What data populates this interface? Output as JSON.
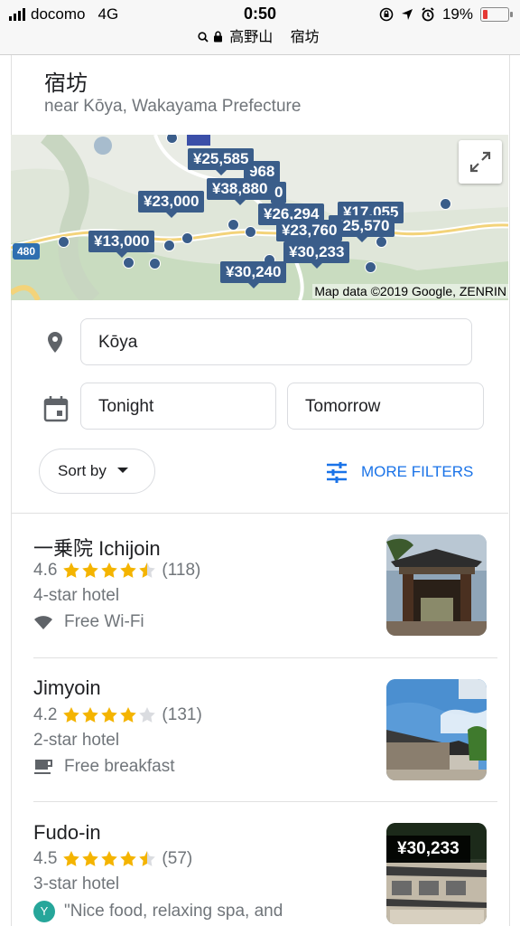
{
  "status_bar": {
    "carrier": "docomo",
    "network": "4G",
    "time": "0:50",
    "battery_percent": "19%",
    "battery_level": 0.19
  },
  "url_bar": {
    "query_1": "高野山",
    "query_2": "宿坊"
  },
  "header": {
    "title": "宿坊",
    "subtitle": "near Kōya, Wakayama Prefecture"
  },
  "map": {
    "prices": [
      "¥25,585",
      "968",
      "¥38,880",
      "0",
      "¥23,000",
      "¥26,294",
      "¥17,055",
      "¥23,760",
      "¥25,570",
      "¥13,000",
      "¥30,233",
      "¥30,240"
    ],
    "route_number": "480",
    "attribution": "Map data ©2019 Google, ZENRIN"
  },
  "form": {
    "location_value": "Kōya",
    "checkin_value": "Tonight",
    "checkout_value": "Tomorrow",
    "sort_label": "Sort by",
    "more_filters_label": "MORE FILTERS"
  },
  "results": [
    {
      "name": "一乗院 Ichijoin",
      "rating": "4.6",
      "stars": 4.6,
      "reviews": "(118)",
      "class": "4-star hotel",
      "amenity": "Free Wi-Fi",
      "amenity_icon": "wifi-icon"
    },
    {
      "name": "Jimyoin",
      "rating": "4.2",
      "stars": 4.2,
      "reviews": "(131)",
      "class": "2-star hotel",
      "amenity": "Free breakfast",
      "amenity_icon": "coffee-icon"
    },
    {
      "name": "Fudo-in",
      "rating": "4.5",
      "stars": 4.5,
      "reviews": "(57)",
      "class": "3-star hotel",
      "amenity": "\"Nice food, relaxing spa, and",
      "amenity_icon": "review-avatar",
      "price": "¥30,233"
    }
  ],
  "colors": {
    "accent": "#1a73e8",
    "map_marker": "#3a5d8a",
    "star": "#f4b400",
    "battery_low": "#e53935"
  }
}
